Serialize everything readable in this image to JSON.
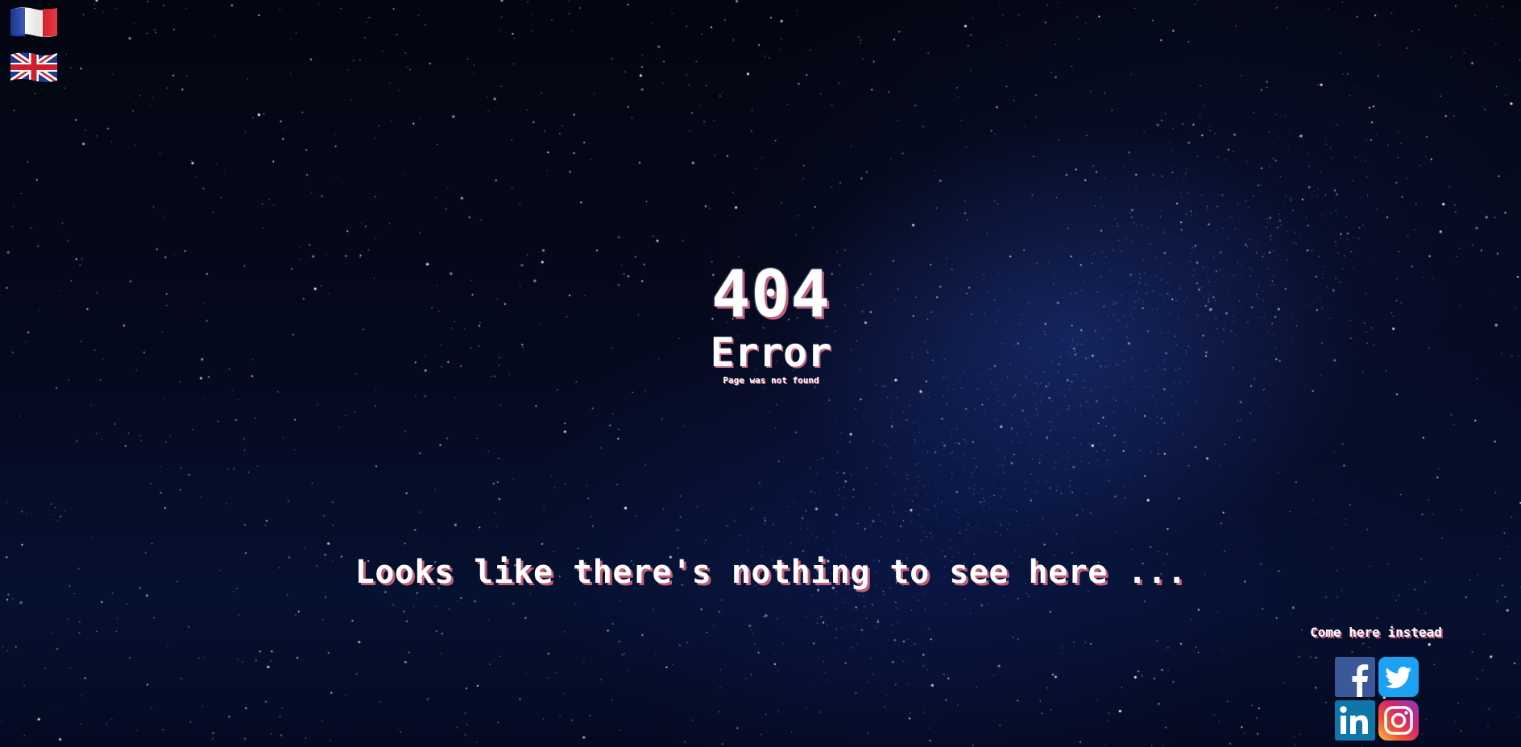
{
  "languages": [
    {
      "code": "fr",
      "label": "Français",
      "icon": "france-flag-icon"
    },
    {
      "code": "en",
      "label": "English",
      "icon": "uk-flag-icon"
    }
  ],
  "error": {
    "code": "404",
    "title": "Error",
    "subtitle": "Page was not found"
  },
  "message": "Looks like there's nothing to see here ...",
  "social": {
    "heading": "Come here instead",
    "links": [
      {
        "name": "Facebook",
        "icon": "facebook-icon"
      },
      {
        "name": "Twitter",
        "icon": "twitter-icon"
      },
      {
        "name": "LinkedIn",
        "icon": "linkedin-icon"
      },
      {
        "name": "Instagram",
        "icon": "instagram-icon"
      }
    ]
  },
  "colors": {
    "background": "#02040c",
    "text": "#ffffff",
    "text_shadow": "#c0607a",
    "facebook": "#3b5998",
    "twitter": "#1da1f2",
    "linkedin": "#0e76a8"
  }
}
